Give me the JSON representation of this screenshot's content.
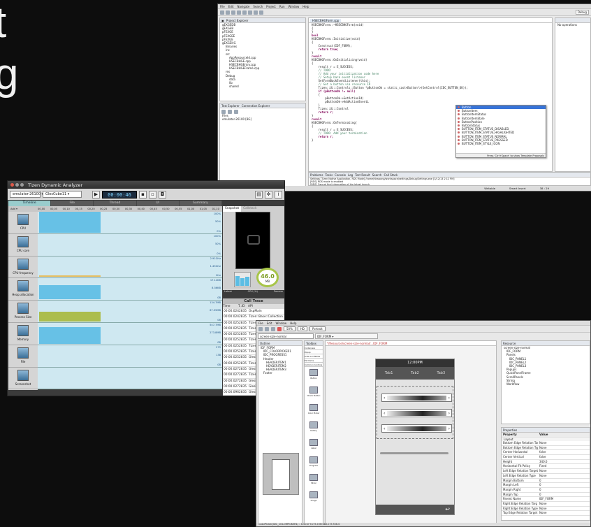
{
  "slide": {
    "title_lines": [
      "t",
      "g"
    ]
  },
  "ide": {
    "menu": [
      "File",
      "Edit",
      "Navigate",
      "Search",
      "Project",
      "Run",
      "Window",
      "Help"
    ],
    "perspective": "Debug",
    "project_explorer": {
      "title": "Project Explorer",
      "items": [
        "gEXGEDB",
        "gEXGEB",
        "pFEXGE",
        "pFEXGEE",
        "pFEXGE",
        "gEXGEHG",
        "Binaries",
        "inc",
        "src",
        "AppResourceId.cpp",
        "HSECBHGE.cpp",
        "HSECBHGEntry.cpp",
        "HSECBHGEFrame.cpp",
        "res",
        "Debug",
        "data",
        "lib",
        "shared"
      ]
    },
    "connection_explorer": {
      "tabs": [
        "Test Explorer",
        "Connection Explorer"
      ],
      "files_label": "Files",
      "device": "emulator-26100 [8G]"
    },
    "editor_tab": "HSECBHGForm.cpp",
    "code_lines": [
      {
        "t": "HSECBHGForm::~HSECBHGForm(void)",
        "c": "n"
      },
      {
        "t": "{",
        "c": "n"
      },
      {
        "t": "}",
        "c": "n"
      },
      {
        "t": "",
        "c": "n"
      },
      {
        "t": "bool",
        "c": "k"
      },
      {
        "t": "HSECBHGForm::Initialize(void)",
        "c": "n"
      },
      {
        "t": "{",
        "c": "n"
      },
      {
        "t": "    Construct(IDF_FORM);",
        "c": "n"
      },
      {
        "t": "    return true;",
        "c": "k"
      },
      {
        "t": "}",
        "c": "n"
      },
      {
        "t": "result",
        "c": "k"
      },
      {
        "t": "HSECBHGForm::OnInitializing(void)",
        "c": "n"
      },
      {
        "t": "{",
        "c": "n"
      },
      {
        "t": "    result r = E_SUCCESS;",
        "c": "n"
      },
      {
        "t": "",
        "c": "n"
      },
      {
        "t": "    // TODO:",
        "c": "c"
      },
      {
        "t": "    // Add your initialization code here",
        "c": "c"
      },
      {
        "t": "",
        "c": "n"
      },
      {
        "t": "    // Setup back event listener",
        "c": "c"
      },
      {
        "t": "    SetFormBackEventListener(this);",
        "c": "n"
      },
      {
        "t": "",
        "c": "n"
      },
      {
        "t": "    // Get a button via resource ID",
        "c": "c"
      },
      {
        "t": "    Tizen::Ui::Controls::Button *pButtonOk = static_cast<Button*>(GetControl(IDC_BUTTON_OK));",
        "c": "n"
      },
      {
        "t": "    if (pButtonOk != null)",
        "c": "k"
      },
      {
        "t": "    {",
        "c": "n"
      },
      {
        "t": "        pButtonOk->SetActionId(",
        "c": "n"
      },
      {
        "t": "        pButtonOk->AddActionEventL",
        "c": "n"
      },
      {
        "t": "    }",
        "c": "n"
      },
      {
        "t": "",
        "c": "n"
      },
      {
        "t": "    Tizen::Ui::Control",
        "c": "n"
      },
      {
        "t": "",
        "c": "n"
      },
      {
        "t": "    return r;",
        "c": "k"
      },
      {
        "t": "}",
        "c": "n"
      },
      {
        "t": "",
        "c": "n"
      },
      {
        "t": "result",
        "c": "k"
      },
      {
        "t": "HSECBHGForm::OnTerminating(",
        "c": "n"
      },
      {
        "t": "{",
        "c": "n"
      },
      {
        "t": "    result r = E_SUCCESS;",
        "c": "n"
      },
      {
        "t": "",
        "c": "n"
      },
      {
        "t": "    // TODO: Add your termination",
        "c": "c"
      },
      {
        "t": "",
        "c": "n"
      },
      {
        "t": "    return r;",
        "c": "k"
      },
      {
        "t": "}",
        "c": "n"
      }
    ],
    "autocomplete": {
      "items": [
        "Button",
        "ButtonItem",
        "ButtonItemStatus",
        "ButtonItemStyle",
        "ButtonPosition",
        "ButtonStatus",
        "BUTTON_ITEM_STATUS_DISABLED",
        "BUTTON_ITEM_STATUS_HIGHLIGHTED",
        "BUTTON_ITEM_STATUS_NORMAL",
        "BUTTON_ITEM_STATUS_PRESSED",
        "BUTTON_ITEM_STYLE_ICON"
      ],
      "hint": "Press 'Ctrl+Space' to show Template Proposals"
    },
    "outline_note": "No operations",
    "console": {
      "tabs": [
        "Problems",
        "Tasks",
        "Console",
        "Log",
        "Test Result",
        "Search",
        "Call Stack"
      ],
      "lines": [
        "Settings [Tizen Native Application, RDS Mode] /home/hkwoong/workspace/settings/Debug/Settings.exe [3/12/13 2:12 PM]",
        "[RDS] RDS mode is enabled",
        "[RDS] Cannot find information of the latest launch."
      ]
    },
    "status": [
      "Writable",
      "Smart Insert",
      "38 : 29"
    ]
  },
  "analyzer": {
    "title": "Tizen Dynamic Analyzer",
    "device": "emulator-26100",
    "app": "GlesCube11",
    "timer": "00:00:46",
    "tabs": [
      "Timeline",
      "File",
      "Thread",
      "UI",
      "Summary"
    ],
    "add_label": "Add",
    "ruler": [
      "00,00",
      "00,05",
      "00,10",
      "00,15",
      "00,20",
      "00,25",
      "00,30",
      "00,35",
      "00,40",
      "00,45",
      "00,50",
      "00,55",
      "01,00",
      "01,05",
      "01,10"
    ],
    "rows": [
      {
        "label": "CPU",
        "top": "100%",
        "mid": "50%",
        "bot": "0%"
      },
      {
        "label": "CPU core",
        "top": "100%",
        "mid": "50%",
        "bot": "0%"
      },
      {
        "label": "CPU frequency",
        "top": "2.91GHz",
        "mid": "1.45GHz",
        "bot": "0Hz"
      },
      {
        "label": "Heap allocation",
        "top": "17.14KB",
        "mid": "8.56KB",
        "bot": "0B"
      },
      {
        "label": "Process Size",
        "top": "134.7MB",
        "mid": "67.35MB",
        "bot": "0B"
      },
      {
        "label": "Memory",
        "top": "547.7MB",
        "mid": "273.8MB",
        "bot": "0B"
      },
      {
        "label": "File",
        "top": "275",
        "mid": "138",
        "bot": "0B"
      },
      {
        "label": "Screenshot",
        "top": "",
        "mid": "",
        "bot": ""
      }
    ],
    "snapshot_tabs": [
      "Snapshot",
      "Callstack"
    ],
    "gauge_value": "46.0",
    "gauge_unit": "MB",
    "gauge_labels": [
      "Latest",
      "CPU (%)",
      "Process"
    ],
    "calltrace": {
      "title": "Call Trace",
      "headers": [
        "Time",
        "T..ID",
        "API"
      ],
      "rows": [
        [
          "00:00.024",
          "2835",
          "OspMain"
        ],
        [
          "00:00.024",
          "2835",
          "Tizen::Base::Collection"
        ],
        [
          "00:00.025",
          "2835",
          "Tizen"
        ],
        [
          "00:00.025",
          "2835",
          "Tizen"
        ],
        [
          "00:00.025",
          "2835",
          "Tizen"
        ],
        [
          "00:00.025",
          "2835",
          "Tizen"
        ],
        [
          "00:00.025",
          "2835",
          "Tizen"
        ],
        [
          "00:00.025",
          "2835",
          "Tizen"
        ],
        [
          "00:00.025",
          "2835",
          "Glesi"
        ],
        [
          "00:00.025",
          "2835",
          "Tizen"
        ],
        [
          "00:00.027",
          "2835",
          "Glesi"
        ],
        [
          "00:00.027",
          "2835",
          "Tizen"
        ],
        [
          "00:00.027",
          "2835",
          "Glesi"
        ],
        [
          "00:00.027",
          "2835",
          "Glesi"
        ],
        [
          "00:00.096",
          "2835",
          "Glesi"
        ],
        [
          "00:00.148",
          "2835",
          "Glesi"
        ]
      ]
    }
  },
  "builder": {
    "menu": [
      "File",
      "Edit",
      "Window",
      "Help"
    ],
    "zoom": "50%",
    "res": "HD",
    "orient": "Portrait",
    "screen_tab": "screen-size-normal",
    "form_combo": "IDF_FORM",
    "editor_tab": "*/Resource/screen-size-normal/...IDF_FORM",
    "outline_title": "Outline",
    "outline": [
      "IDF_FORM",
      "IDC_COLORPICKER1",
      "IDC_PROGRESS1",
      "Header",
      "HEADERITEM1",
      "HEADERITEM2",
      "HEADERITEM3",
      "Footer"
    ],
    "toolbox_title": "Toolbox",
    "toolbox_cats": [
      "Containers",
      "Popup",
      "Lists and Tables",
      "Ext Items",
      "Common Controls"
    ],
    "toolbox_items": [
      "Button",
      "Check Button",
      "Color Picker",
      "Gallery",
      "Label",
      "Progress",
      "Slider",
      "Image"
    ],
    "resource_title": "Resource",
    "resource_tree": [
      "screen-size-normal",
      "IDF_FORM",
      "Panels",
      "IDC_PANEL1",
      "IDC_PANEL2",
      "IDC_PANEL3",
      "Popups",
      "QuickPanelFrame",
      "ScrollPanels",
      "String",
      "Workflow"
    ],
    "phone": {
      "time": "12:00PM",
      "tabs": [
        "Tab1",
        "Tab2",
        "Tab3"
      ]
    },
    "properties_title": "Properties",
    "props_head": [
      "Property",
      "Value"
    ],
    "props_section": "Layout",
    "props": [
      [
        "Bottom Edge Relation Targ",
        "None"
      ],
      [
        "Bottom Edge Relation Type",
        "None"
      ],
      [
        "Center Horizontal",
        "false"
      ],
      [
        "Center Vertical",
        "false"
      ],
      [
        "Height",
        "340.0"
      ],
      [
        "Horizontal Fit Policy",
        "Fixed"
      ],
      [
        "Left Edge Relation Target",
        "None"
      ],
      [
        "Left Edge Relation Type",
        "None"
      ],
      [
        "Margin Bottom",
        "0"
      ],
      [
        "Margin Left",
        "0"
      ],
      [
        "Margin Right",
        "0"
      ],
      [
        "Margin Top",
        "0"
      ],
      [
        "Parent Name",
        "IDF_FORM"
      ],
      [
        "Right Edge Relation Targ",
        "None"
      ],
      [
        "Right Edge Relation Type",
        "None"
      ],
      [
        "Top Edge Relation Target",
        "None"
      ]
    ],
    "status": "ColorPicker(IDC_COLORPICKER1) : X:50.0 Y:175.0 W:680.0 H:356.0"
  },
  "colors": {
    "accent": "#3874d8",
    "graph_fill": "#5bbde4",
    "timer_text": "#7fd3ff"
  }
}
